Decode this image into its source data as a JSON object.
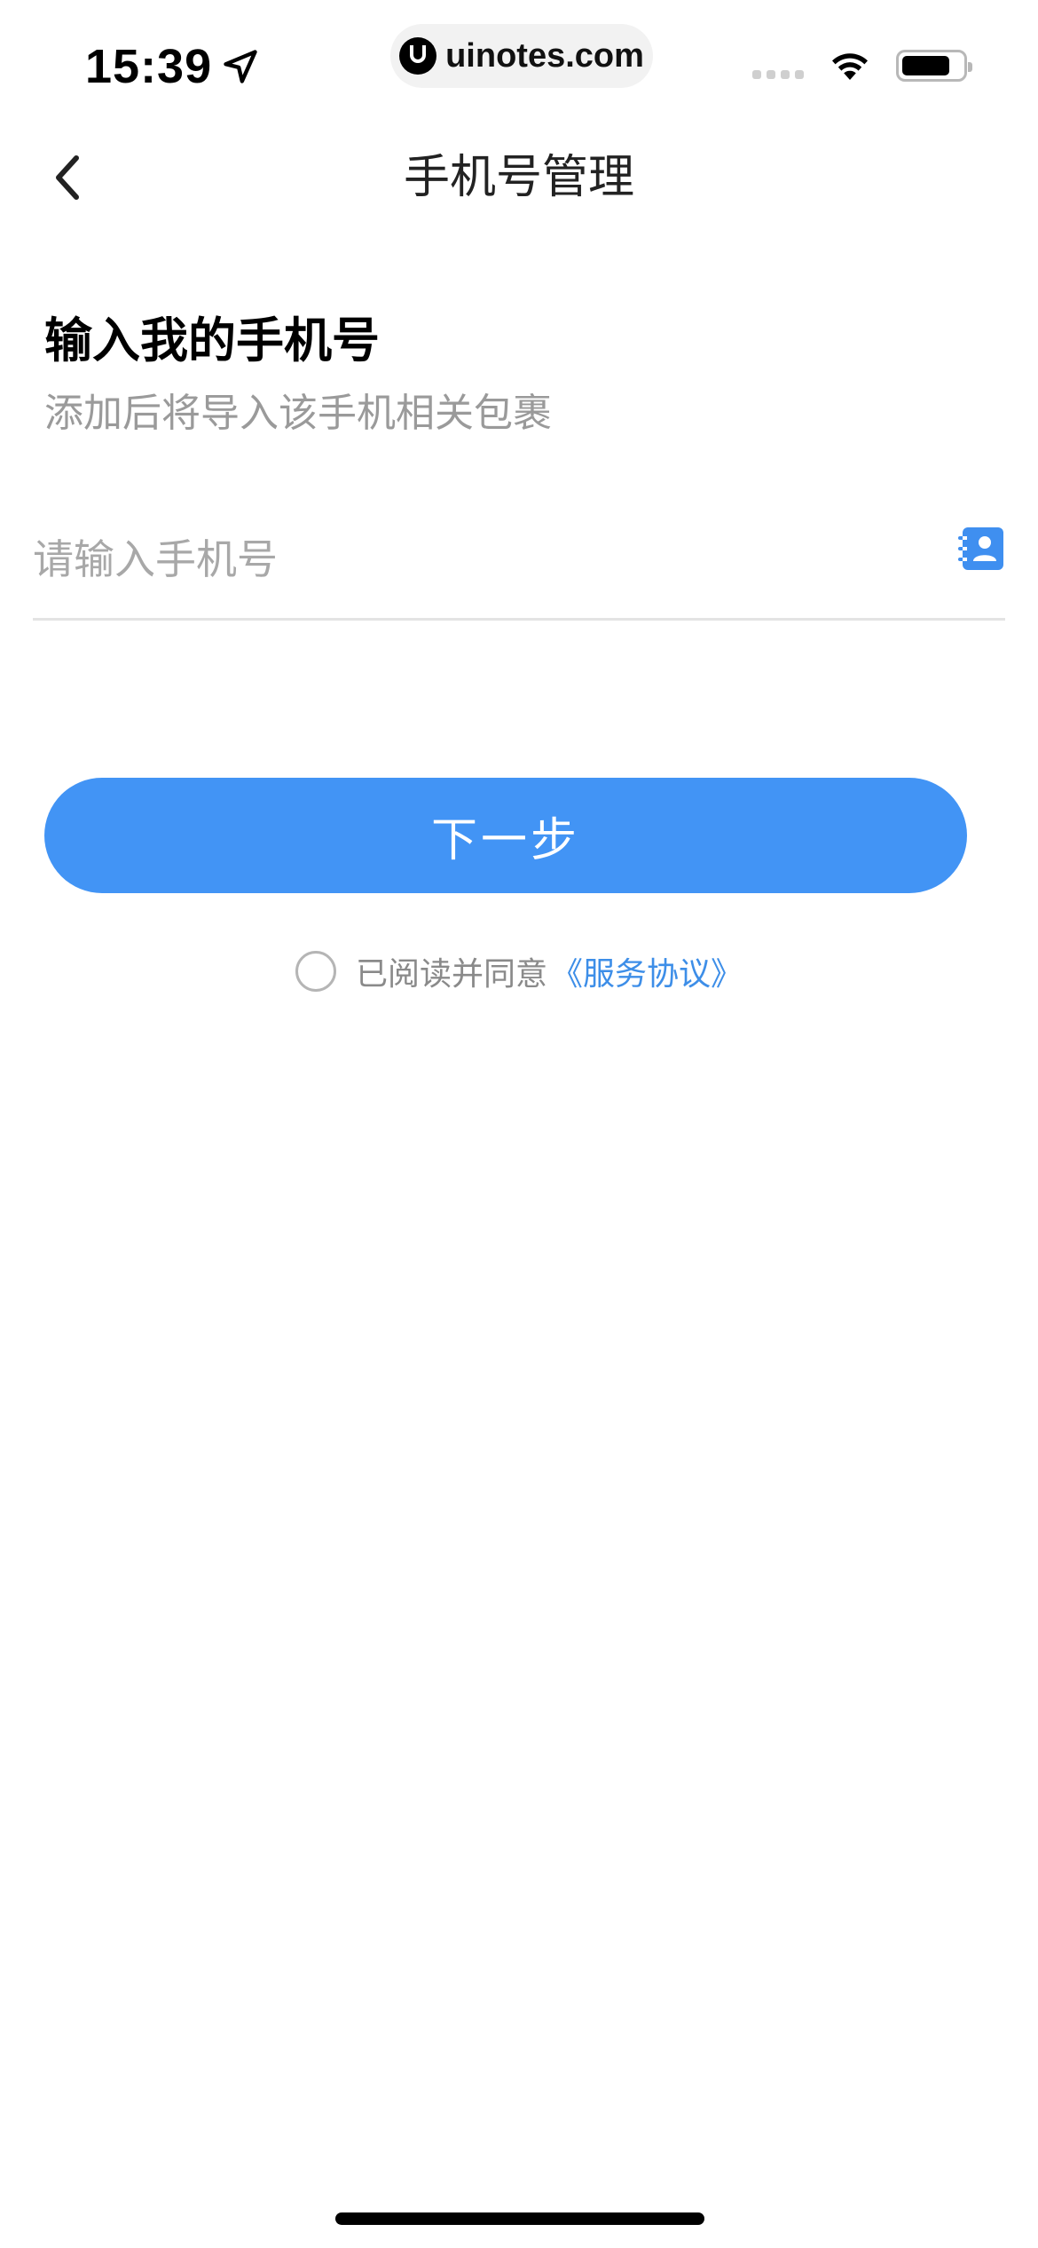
{
  "status_bar": {
    "time": "15:39",
    "url": "uinotes.com",
    "battery_level": 0.8
  },
  "nav": {
    "title": "手机号管理",
    "back_icon": "chevron-left-icon"
  },
  "form": {
    "heading": "输入我的手机号",
    "subheading": "添加后将导入该手机相关包裹",
    "phone_placeholder": "请输入手机号",
    "phone_value": "",
    "contacts_icon": "contact-book-icon",
    "next_label": "下一步"
  },
  "agreement": {
    "checked": false,
    "text": "已阅读并同意",
    "link_label": "《服务协议》"
  },
  "colors": {
    "primary": "#4294f5",
    "link": "#3d8ee8",
    "muted_text": "#9a9a9a"
  }
}
